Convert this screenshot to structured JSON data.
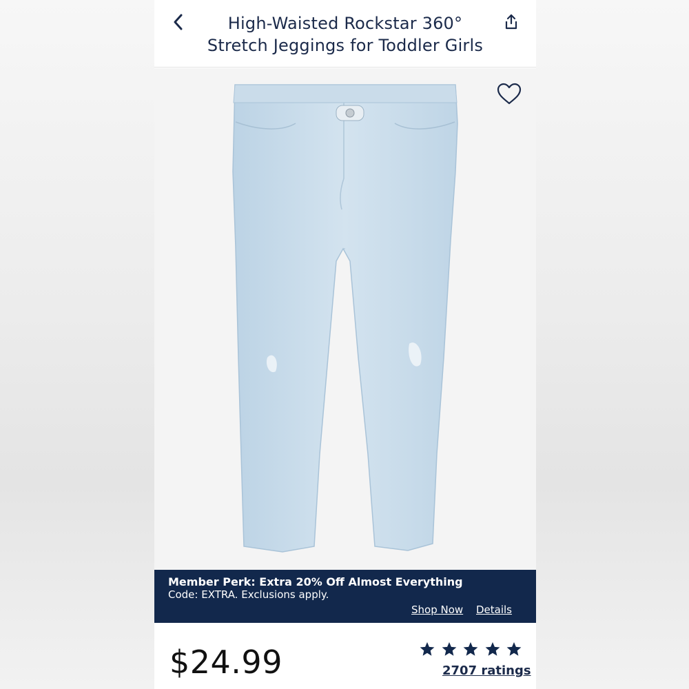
{
  "header": {
    "title_line1": "High-Waisted Rockstar 360°",
    "title_line2": "Stretch Jeggings for Toddler Girls",
    "back_icon": "chevron-left-icon",
    "share_icon": "share-icon"
  },
  "product": {
    "image_alt": "light-wash distressed toddler jeggings",
    "favorite_icon": "heart-outline-icon"
  },
  "promo": {
    "title": "Member Perk: Extra 20% Off Almost Everything",
    "subtitle": "Code: EXTRA. Exclusions apply.",
    "shop_now": "Shop Now",
    "details": "Details",
    "background": "#12284c"
  },
  "pricing": {
    "price": "$24.99"
  },
  "rating": {
    "stars": 5,
    "count_label": "2707 ratings",
    "star_color": "#12284c"
  },
  "colors": {
    "title": "#1b2a4a",
    "denim": "#c9dcea"
  }
}
